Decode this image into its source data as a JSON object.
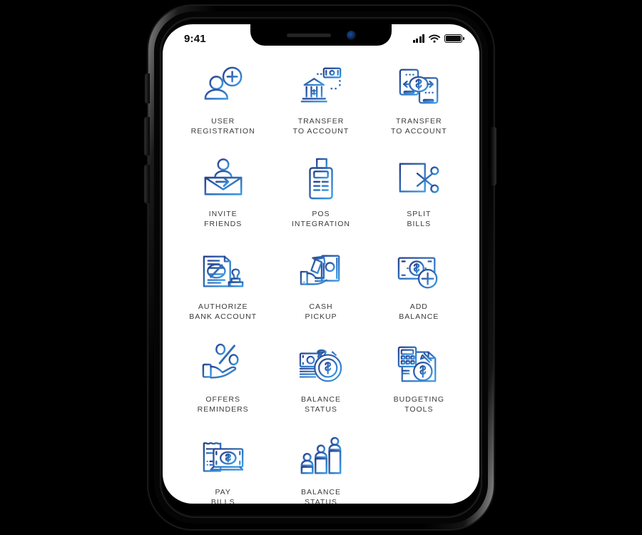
{
  "device": {
    "type": "smartphone-mockup",
    "frame_color": "#000000",
    "screen_background": "#ffffff"
  },
  "status_bar": {
    "time": "9:41",
    "signal_icon": "signal-bars-icon",
    "wifi_icon": "wifi-icon",
    "battery_icon": "battery-full-icon"
  },
  "theme": {
    "icon_gradient_start": "#27418c",
    "icon_gradient_end": "#3d9ce8",
    "label_color": "#3a3a3c",
    "screen_bg": "#ffffff"
  },
  "grid": {
    "columns": 3,
    "items": [
      {
        "id": "user-registration",
        "icon": "user-add-icon",
        "label": "USER\nREGISTRATION"
      },
      {
        "id": "transfer-to-account",
        "icon": "bank-transfer-icon",
        "label": "TRANSFER\nTO ACCOUNT"
      },
      {
        "id": "transfer-to-account-mobile",
        "icon": "mobile-transfer-icon",
        "label": "TRANSFER\nTO ACCOUNT"
      },
      {
        "id": "invite-friends",
        "icon": "invite-envelope-icon",
        "label": "INVITE\nFRIENDS"
      },
      {
        "id": "pos-integration",
        "icon": "pos-terminal-icon",
        "label": "POS\nINTEGRATION"
      },
      {
        "id": "split-bills",
        "icon": "scissors-cut-icon",
        "label": "SPLIT\nBILLS"
      },
      {
        "id": "authorize-bank-account",
        "icon": "document-stamp-icon",
        "label": "AUTHORIZE\nBANK ACCOUNT"
      },
      {
        "id": "cash-pickup",
        "icon": "hand-cash-icon",
        "label": "CASH\nPICKUP"
      },
      {
        "id": "add-balance",
        "icon": "banknote-plus-icon",
        "label": "ADD\nBALANCE"
      },
      {
        "id": "offers-reminders",
        "icon": "hand-percent-icon",
        "label": "OFFERS\nREMINDERS"
      },
      {
        "id": "balance-status",
        "icon": "money-bag-icon",
        "label": "BALANCE\nSTATUS"
      },
      {
        "id": "budgeting-tools",
        "icon": "calculator-doc-icon",
        "label": "BUDGETING\nTOOLS"
      },
      {
        "id": "pay-bills",
        "icon": "invoice-money-icon",
        "label": "PAY\nBILLS"
      },
      {
        "id": "balance-status-chart",
        "icon": "people-bar-chart-icon",
        "label": "BALANCE\nSTATUS"
      }
    ]
  }
}
